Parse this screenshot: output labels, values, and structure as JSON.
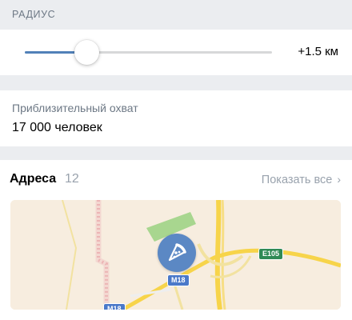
{
  "radius": {
    "header": "РАДИУС",
    "value_label": "+1.5 км",
    "slider_fraction": 0.25
  },
  "reach": {
    "label": "Приблизительный охват",
    "value": "17 000 человек"
  },
  "addresses": {
    "title": "Адреса",
    "count": "12",
    "show_all": "Показать все",
    "map": {
      "road_labels": {
        "m18": "M18",
        "e105": "E105",
        "m18_bottom": "M18"
      },
      "pin_icon": "pizza-icon"
    }
  },
  "colors": {
    "accent": "#5181b8",
    "secondary_text": "#6d7885",
    "muted_text": "#99a2ad",
    "background": "#ebedf0"
  }
}
